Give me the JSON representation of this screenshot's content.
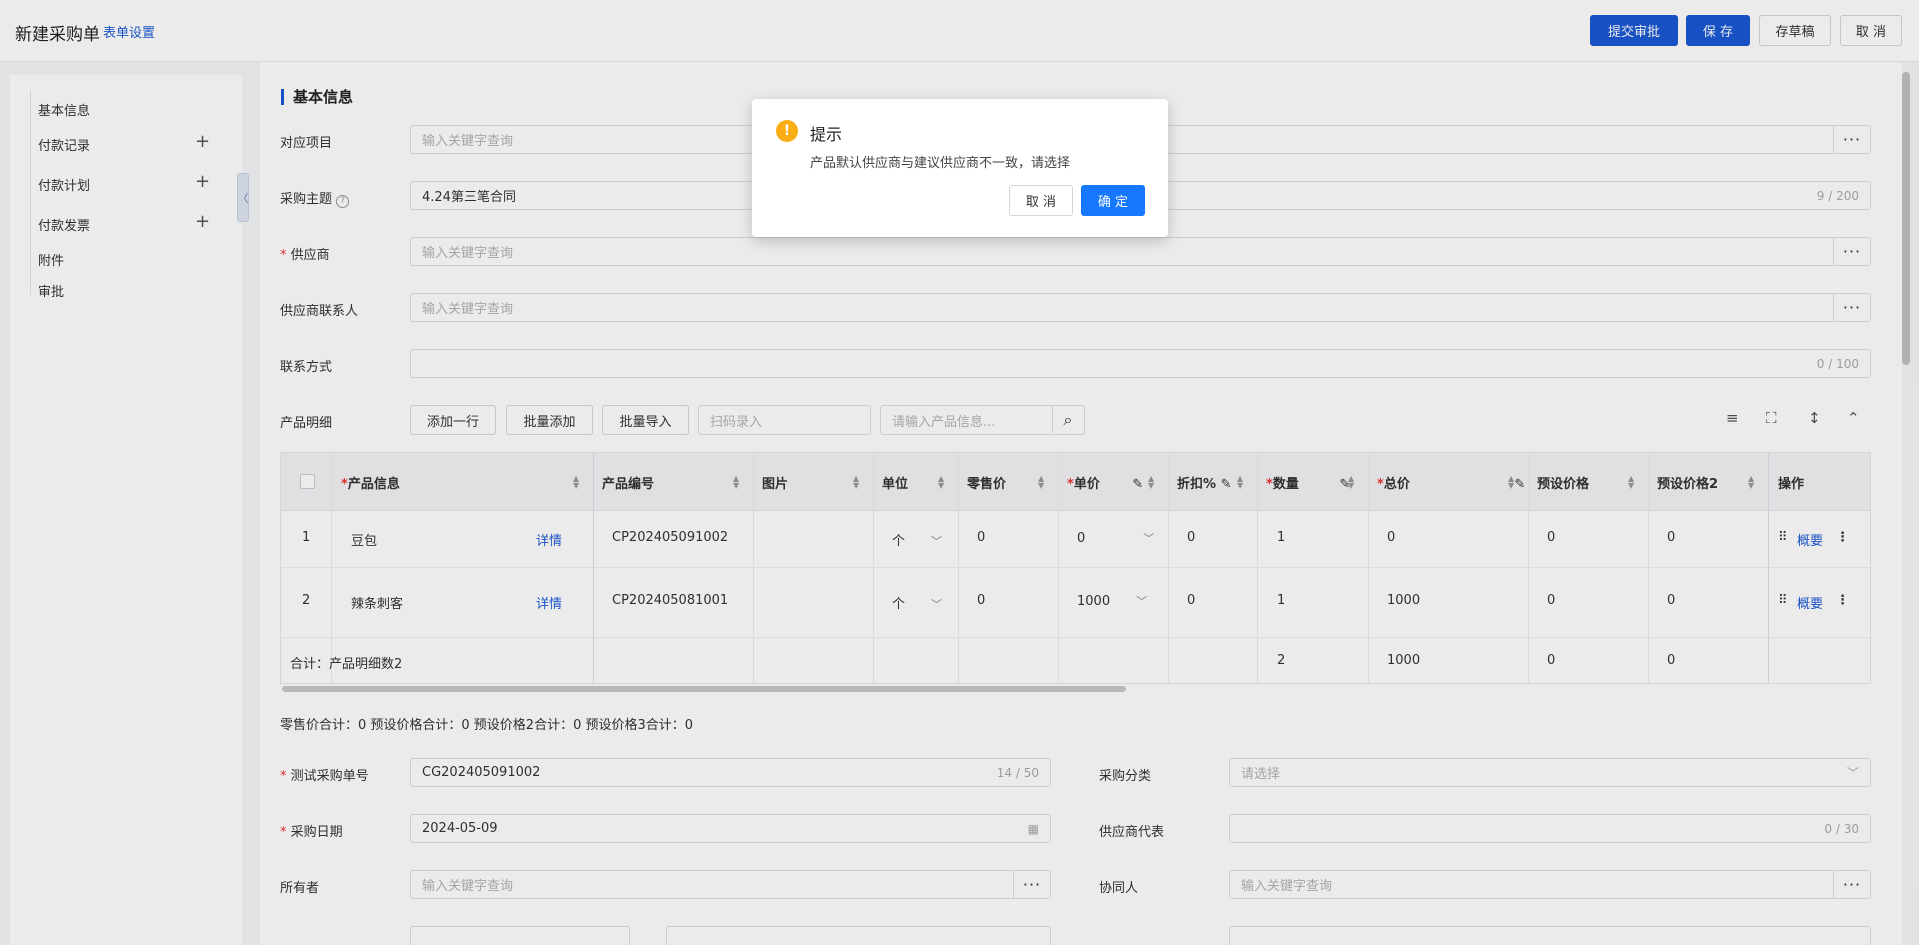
{
  "header": {
    "title": "新建采购单",
    "form_settings": "表单设置",
    "submit": "提交审批",
    "save": "保 存",
    "draft": "存草稿",
    "cancel": "取 消"
  },
  "sidebar": {
    "items": [
      {
        "label": "基本信息"
      },
      {
        "label": "付款记录",
        "plus": "+"
      },
      {
        "label": "付款计划",
        "plus": "+"
      },
      {
        "label": "付款发票",
        "plus": "+"
      },
      {
        "label": "附件"
      },
      {
        "label": "审批"
      }
    ],
    "collapse": "〈"
  },
  "section_title": "基本信息",
  "form": {
    "project": {
      "label": "对应项目",
      "placeholder": "输入关键字查询"
    },
    "subject": {
      "label": "采购主题",
      "value": "4.24第三笔合同",
      "count": "9 / 200"
    },
    "supplier": {
      "label": "供应商",
      "placeholder": "输入关键字查询"
    },
    "supplier_contact": {
      "label": "供应商联系人",
      "placeholder": "输入关键字查询"
    },
    "contact": {
      "label": "联系方式",
      "count": "0 / 100"
    }
  },
  "product": {
    "label": "产品明细",
    "add_row": "添加一行",
    "batch_add": "批量添加",
    "batch_import": "批量导入",
    "scan_placeholder": "扫码录入",
    "search_placeholder": "请输入产品信息...",
    "columns": [
      "产品信息",
      "产品编号",
      "图片",
      "单位",
      "零售价",
      "单价",
      "折扣%",
      "数量",
      "总价",
      "预设价格",
      "预设价格2",
      "操作"
    ],
    "rows": [
      {
        "no": "1",
        "name": "豆包",
        "detail": "详情",
        "code": "CP202405091002",
        "unit": "个",
        "retail": "0",
        "price": "0",
        "discount": "0",
        "qty": "1",
        "total": "0",
        "preset": "0",
        "preset2": "0",
        "op": "概要"
      },
      {
        "no": "2",
        "name": "辣条刺客",
        "detail": "详情",
        "code": "CP202405081001",
        "unit": "个",
        "retail": "0",
        "price": "1000",
        "discount": "0",
        "qty": "1",
        "total": "1000",
        "preset": "0",
        "preset2": "0",
        "op": "概要"
      }
    ],
    "total_row": {
      "label": "合计：产品明细数2",
      "qty": "2",
      "total": "1000",
      "preset": "0",
      "preset2": "0"
    },
    "summary": "零售价合计：0  预设价格合计：0  预设价格2合计：0  预设价格3合计：0"
  },
  "form2": {
    "order_no": {
      "label": "测试采购单号",
      "value": "CG202405091002",
      "count": "14 / 50"
    },
    "category": {
      "label": "采购分类",
      "placeholder": "请选择"
    },
    "date": {
      "label": "采购日期",
      "value": "2024-05-09"
    },
    "supplier_rep": {
      "label": "供应商代表",
      "count": "0 / 30"
    },
    "owner": {
      "label": "所有者",
      "placeholder": "输入关键字查询"
    },
    "collaborator": {
      "label": "协同人",
      "placeholder": "输入关键字查询"
    }
  },
  "dialog": {
    "title": "提示",
    "message": "产品默认供应商与建议供应商不一致，请选择",
    "cancel": "取 消",
    "confirm": "确 定"
  }
}
